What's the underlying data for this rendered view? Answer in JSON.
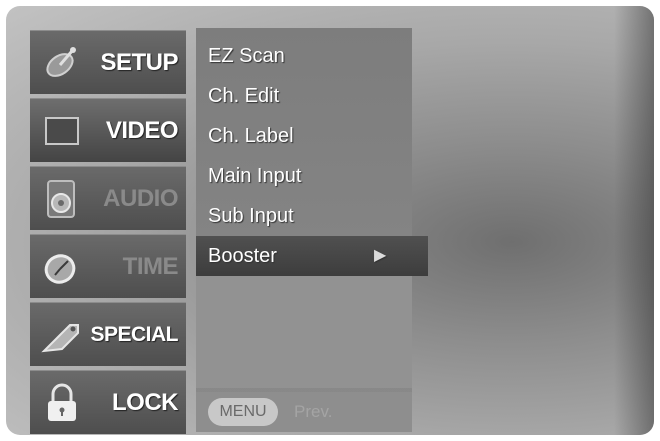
{
  "tabs": [
    {
      "label": "SETUP",
      "icon": "satellite-dish-icon",
      "state": "normal"
    },
    {
      "label": "VIDEO",
      "icon": "screen-icon",
      "state": "active"
    },
    {
      "label": "AUDIO",
      "icon": "speaker-icon",
      "state": "dim"
    },
    {
      "label": "TIME",
      "icon": "clock-icon",
      "state": "dim"
    },
    {
      "label": "SPECIAL",
      "icon": "tag-icon",
      "state": "normal"
    },
    {
      "label": "LOCK",
      "icon": "padlock-icon",
      "state": "normal"
    }
  ],
  "menu": {
    "items": [
      "EZ Scan",
      "Ch. Edit",
      "Ch. Label",
      "Main Input",
      "Sub Input",
      "Booster"
    ],
    "selected_index": 5,
    "selected_arrow": "▶"
  },
  "footer": {
    "menu_button": "MENU",
    "prev_label": "Prev."
  },
  "colors": {
    "panel": "#5a5a5a",
    "menu_bg": "#858585",
    "text": "#ffffff",
    "selected_bg": "#474747"
  }
}
